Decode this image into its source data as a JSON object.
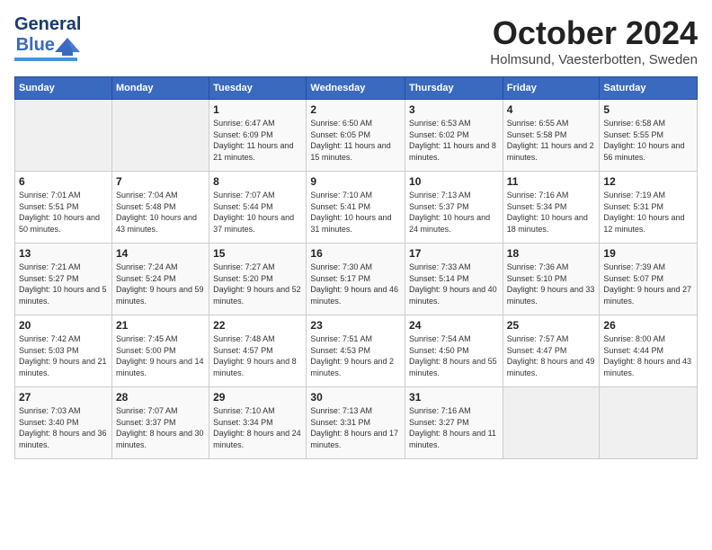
{
  "header": {
    "logo_general": "General",
    "logo_blue": "Blue",
    "month": "October 2024",
    "location": "Holmsund, Vaesterbotten, Sweden"
  },
  "days_of_week": [
    "Sunday",
    "Monday",
    "Tuesday",
    "Wednesday",
    "Thursday",
    "Friday",
    "Saturday"
  ],
  "weeks": [
    [
      {
        "day": "",
        "info": ""
      },
      {
        "day": "",
        "info": ""
      },
      {
        "day": "1",
        "info": "Sunrise: 6:47 AM\nSunset: 6:09 PM\nDaylight: 11 hours and 21 minutes."
      },
      {
        "day": "2",
        "info": "Sunrise: 6:50 AM\nSunset: 6:05 PM\nDaylight: 11 hours and 15 minutes."
      },
      {
        "day": "3",
        "info": "Sunrise: 6:53 AM\nSunset: 6:02 PM\nDaylight: 11 hours and 8 minutes."
      },
      {
        "day": "4",
        "info": "Sunrise: 6:55 AM\nSunset: 5:58 PM\nDaylight: 11 hours and 2 minutes."
      },
      {
        "day": "5",
        "info": "Sunrise: 6:58 AM\nSunset: 5:55 PM\nDaylight: 10 hours and 56 minutes."
      }
    ],
    [
      {
        "day": "6",
        "info": "Sunrise: 7:01 AM\nSunset: 5:51 PM\nDaylight: 10 hours and 50 minutes."
      },
      {
        "day": "7",
        "info": "Sunrise: 7:04 AM\nSunset: 5:48 PM\nDaylight: 10 hours and 43 minutes."
      },
      {
        "day": "8",
        "info": "Sunrise: 7:07 AM\nSunset: 5:44 PM\nDaylight: 10 hours and 37 minutes."
      },
      {
        "day": "9",
        "info": "Sunrise: 7:10 AM\nSunset: 5:41 PM\nDaylight: 10 hours and 31 minutes."
      },
      {
        "day": "10",
        "info": "Sunrise: 7:13 AM\nSunset: 5:37 PM\nDaylight: 10 hours and 24 minutes."
      },
      {
        "day": "11",
        "info": "Sunrise: 7:16 AM\nSunset: 5:34 PM\nDaylight: 10 hours and 18 minutes."
      },
      {
        "day": "12",
        "info": "Sunrise: 7:19 AM\nSunset: 5:31 PM\nDaylight: 10 hours and 12 minutes."
      }
    ],
    [
      {
        "day": "13",
        "info": "Sunrise: 7:21 AM\nSunset: 5:27 PM\nDaylight: 10 hours and 5 minutes."
      },
      {
        "day": "14",
        "info": "Sunrise: 7:24 AM\nSunset: 5:24 PM\nDaylight: 9 hours and 59 minutes."
      },
      {
        "day": "15",
        "info": "Sunrise: 7:27 AM\nSunset: 5:20 PM\nDaylight: 9 hours and 52 minutes."
      },
      {
        "day": "16",
        "info": "Sunrise: 7:30 AM\nSunset: 5:17 PM\nDaylight: 9 hours and 46 minutes."
      },
      {
        "day": "17",
        "info": "Sunrise: 7:33 AM\nSunset: 5:14 PM\nDaylight: 9 hours and 40 minutes."
      },
      {
        "day": "18",
        "info": "Sunrise: 7:36 AM\nSunset: 5:10 PM\nDaylight: 9 hours and 33 minutes."
      },
      {
        "day": "19",
        "info": "Sunrise: 7:39 AM\nSunset: 5:07 PM\nDaylight: 9 hours and 27 minutes."
      }
    ],
    [
      {
        "day": "20",
        "info": "Sunrise: 7:42 AM\nSunset: 5:03 PM\nDaylight: 9 hours and 21 minutes."
      },
      {
        "day": "21",
        "info": "Sunrise: 7:45 AM\nSunset: 5:00 PM\nDaylight: 9 hours and 14 minutes."
      },
      {
        "day": "22",
        "info": "Sunrise: 7:48 AM\nSunset: 4:57 PM\nDaylight: 9 hours and 8 minutes."
      },
      {
        "day": "23",
        "info": "Sunrise: 7:51 AM\nSunset: 4:53 PM\nDaylight: 9 hours and 2 minutes."
      },
      {
        "day": "24",
        "info": "Sunrise: 7:54 AM\nSunset: 4:50 PM\nDaylight: 8 hours and 55 minutes."
      },
      {
        "day": "25",
        "info": "Sunrise: 7:57 AM\nSunset: 4:47 PM\nDaylight: 8 hours and 49 minutes."
      },
      {
        "day": "26",
        "info": "Sunrise: 8:00 AM\nSunset: 4:44 PM\nDaylight: 8 hours and 43 minutes."
      }
    ],
    [
      {
        "day": "27",
        "info": "Sunrise: 7:03 AM\nSunset: 3:40 PM\nDaylight: 8 hours and 36 minutes."
      },
      {
        "day": "28",
        "info": "Sunrise: 7:07 AM\nSunset: 3:37 PM\nDaylight: 8 hours and 30 minutes."
      },
      {
        "day": "29",
        "info": "Sunrise: 7:10 AM\nSunset: 3:34 PM\nDaylight: 8 hours and 24 minutes."
      },
      {
        "day": "30",
        "info": "Sunrise: 7:13 AM\nSunset: 3:31 PM\nDaylight: 8 hours and 17 minutes."
      },
      {
        "day": "31",
        "info": "Sunrise: 7:16 AM\nSunset: 3:27 PM\nDaylight: 8 hours and 11 minutes."
      },
      {
        "day": "",
        "info": ""
      },
      {
        "day": "",
        "info": ""
      }
    ]
  ]
}
